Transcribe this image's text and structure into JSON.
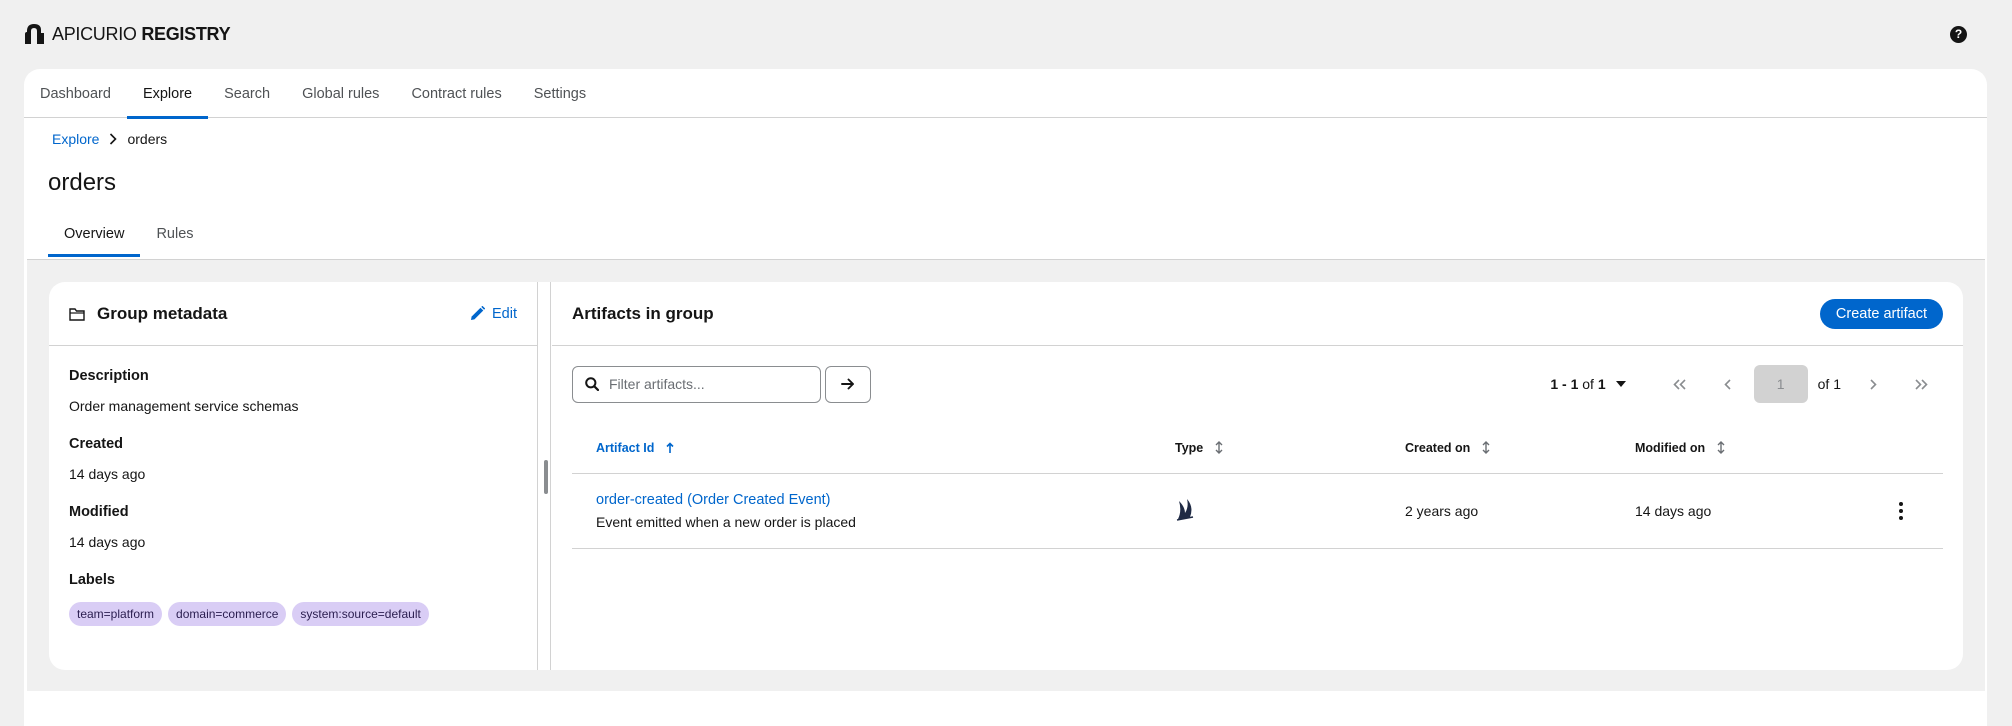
{
  "brand": {
    "name_light": "APICURIO",
    "name_bold": "REGISTRY"
  },
  "help": {
    "glyph": "?"
  },
  "nav": {
    "tabs": [
      "Dashboard",
      "Explore",
      "Search",
      "Global rules",
      "Contract rules",
      "Settings"
    ],
    "active": "Explore"
  },
  "breadcrumb": {
    "parent": "Explore",
    "current": "orders"
  },
  "page": {
    "title": "orders"
  },
  "subtabs": {
    "overview": "Overview",
    "rules": "Rules"
  },
  "metadata": {
    "title": "Group metadata",
    "edit_label": "Edit",
    "description_label": "Description",
    "description": "Order management service schemas",
    "created_label": "Created",
    "created": "14 days ago",
    "modified_label": "Modified",
    "modified": "14 days ago",
    "labels_label": "Labels",
    "labels": [
      "team=platform",
      "domain=commerce",
      "system:source=default"
    ]
  },
  "artifacts": {
    "title": "Artifacts in group",
    "create_label": "Create artifact",
    "filter_placeholder": "Filter artifacts...",
    "pagination": {
      "range": "1 - 1",
      "of_label": "of",
      "total": "1",
      "page": "1",
      "page_of": "of 1"
    },
    "columns": {
      "id": "Artifact Id",
      "type": "Type",
      "created": "Created on",
      "modified": "Modified on"
    },
    "rows": [
      {
        "name": "order-created (Order Created Event)",
        "description": "Event emitted when a new order is placed",
        "type_icon": "asyncapi-icon",
        "created": "2 years ago",
        "modified": "14 days ago"
      }
    ]
  },
  "colors": {
    "accent": "#0066cc",
    "label_bg": "#d9cdf5",
    "page_bg": "#f0f0f0"
  }
}
